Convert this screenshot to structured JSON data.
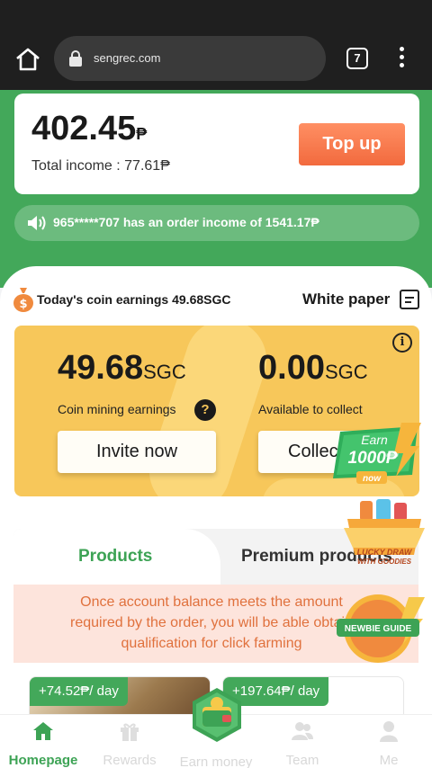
{
  "browser": {
    "url": "sengrec.com",
    "tab_count": "7",
    "icons": [
      "home-icon",
      "lock-icon",
      "tabs-icon",
      "more-vert-icon"
    ]
  },
  "account": {
    "balance_value": "402.45",
    "balance_currency": "₱",
    "total_income": "Total income : 77.61₱",
    "topup_label": "Top up"
  },
  "notice": {
    "text": "965*****707 has an order income of 1541.17₱"
  },
  "coin": {
    "title": "Today's coin earnings 49.68SGC",
    "whitepaper_label": "White paper",
    "mining_value": "49.68",
    "mining_unit": "SGC",
    "mining_label": "Coin mining earnings",
    "collect_value": "0.00",
    "collect_unit": "SGC",
    "collect_label": "Available to collect",
    "invite_label": "Invite now",
    "collect_button_label": "Collect",
    "help_glyph": "?",
    "info_glyph": "i"
  },
  "badges": {
    "earn_line1": "Earn",
    "earn_line2": "1000₱",
    "earn_line3": "now",
    "lucky_line1": "LUCKY DRAW",
    "lucky_line2": "WITH GOODIES",
    "newbie": "NEWBIE GUIDE"
  },
  "tabs": {
    "products": "Products",
    "premium": "Premium products"
  },
  "note": {
    "line1": "Once account balance meets the amount",
    "line2": "required by the order, you will be able obtain",
    "line3": "qualification for click farming"
  },
  "products": [
    {
      "price": "+74.52₱/ day"
    },
    {
      "price": "+197.64₱/ day"
    }
  ],
  "nav": {
    "homepage": "Homepage",
    "rewards": "Rewards",
    "earn_money": "Earn money",
    "team": "Team",
    "me": "Me"
  },
  "colors": {
    "brand_green": "#43a85a",
    "accent_orange": "#f26a3e",
    "gold_card": "#f7c75a",
    "note_pink": "#fde4dc"
  }
}
